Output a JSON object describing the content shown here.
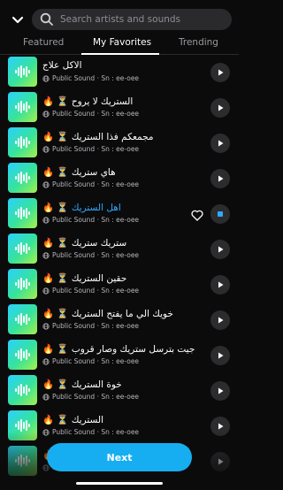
{
  "search": {
    "placeholder": "Search artists and sounds"
  },
  "tabs": [
    {
      "label": "Featured"
    },
    {
      "label": "My Favorites"
    },
    {
      "label": "Trending"
    }
  ],
  "tracks": [
    {
      "title": "الاكل علاج",
      "subtitle": "Public Sound · Sn : ee-oee"
    },
    {
      "title": "🔥 ⏳ الستريك لا يروح",
      "subtitle": "Public Sound · Sn : ee-oee"
    },
    {
      "title": "🔥 ⏳ مجمعكم فذا الستريك",
      "subtitle": "Public Sound · Sn : ee-oee"
    },
    {
      "title": "🔥 ⏳ هاي ستريك",
      "subtitle": "Public Sound · Sn : ee-oee"
    },
    {
      "title": "🔥 ⏳ اهل الستريك",
      "subtitle": "Public Sound · Sn : ee-oee"
    },
    {
      "title": "🔥 ⏳ ستريك ستريك",
      "subtitle": "Public Sound · Sn : ee-oee"
    },
    {
      "title": "🔥 ⏳ حقين الستريك",
      "subtitle": "Public Sound · Sn : ee-oee"
    },
    {
      "title": "🔥 ⏳ خويك الي ما يفتح الستريك",
      "subtitle": "Public Sound · Sn : ee-oee"
    },
    {
      "title": "🔥 ⏳ جيت بترسل ستريك وصار قروب",
      "subtitle": "Public Sound · Sn : ee-oee"
    },
    {
      "title": "🔥 ⏳ خوة الستريك",
      "subtitle": "Public Sound · Sn : ee-oee"
    },
    {
      "title": "🔥 ⏳ الستريك",
      "subtitle": "Public Sound · Sn : ee-oee"
    },
    {
      "title": "🔥 ⏳",
      "subtitle": "Public Sound · Sn : ee-oee"
    }
  ],
  "next_label": "Next",
  "colors": {
    "accent": "#16aef1",
    "active_title": "#2fa9ff"
  },
  "icons": {
    "collapse": "chevron-down-icon",
    "search": "search-icon",
    "play": "play-icon",
    "pause": "pause-icon",
    "favorite": "heart-icon"
  }
}
